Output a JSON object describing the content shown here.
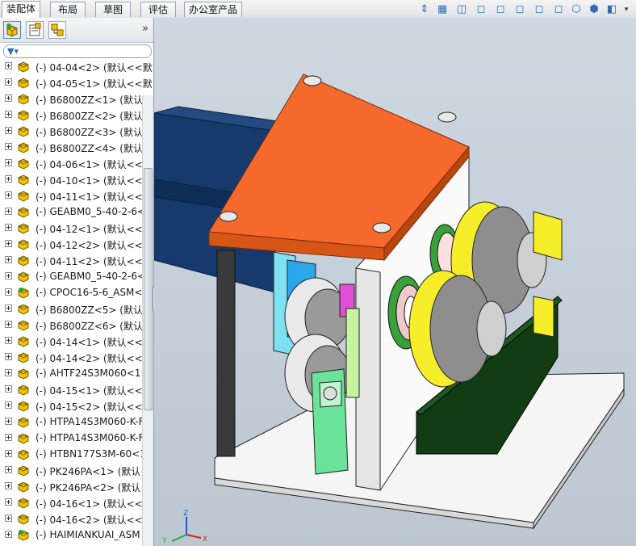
{
  "tabs": [
    "装配体",
    "布局",
    "草图",
    "评估",
    "办公室产品"
  ],
  "active_tab": 0,
  "view_toolbar_icons": [
    "measure-icon",
    "section-view-icon",
    "view-orientation-icon",
    "view-cube-icon",
    "view-cube-icon",
    "view-cube-icon",
    "view-cube-icon",
    "view-cube-icon",
    "display-style-icon",
    "display-style-icon",
    "hide-show-icon"
  ],
  "panel": {
    "tab_icons": [
      "feature-manager-icon",
      "property-manager-icon",
      "configuration-manager-icon"
    ],
    "collapse_label": "»"
  },
  "tree_rows": [
    {
      "label": "(-) 04-04<2> (默认<<默",
      "icon": "part-icon"
    },
    {
      "label": "(-) 04-05<1> (默认<<默",
      "icon": "part-icon"
    },
    {
      "label": "(-) B6800ZZ<1> (默认<",
      "icon": "part-icon"
    },
    {
      "label": "(-) B6800ZZ<2> (默认<",
      "icon": "part-icon"
    },
    {
      "label": "(-) B6800ZZ<3> (默认<",
      "icon": "part-icon"
    },
    {
      "label": "(-) B6800ZZ<4> (默认<",
      "icon": "part-icon"
    },
    {
      "label": "(-) 04-06<1> (默认<<默",
      "icon": "part-icon"
    },
    {
      "label": "(-) 04-10<1> (默认<<默",
      "icon": "part-icon"
    },
    {
      "label": "(-) 04-11<1> (默认<<默",
      "icon": "part-icon"
    },
    {
      "label": "(-) GEABM0_5-40-2-6<",
      "icon": "part-icon"
    },
    {
      "label": "(-) 04-12<1> (默认<<默",
      "icon": "part-icon"
    },
    {
      "label": "(-) 04-12<2> (默认<<默",
      "icon": "part-icon"
    },
    {
      "label": "(-) 04-11<2> (默认<<默",
      "icon": "part-icon"
    },
    {
      "label": "(-) GEABM0_5-40-2-6<",
      "icon": "part-icon"
    },
    {
      "label": "(-) CPOC16-5-6_ASM<",
      "icon": "assembly-icon"
    },
    {
      "label": "(-) B6800ZZ<5> (默认<",
      "icon": "part-icon"
    },
    {
      "label": "(-) B6800ZZ<6> (默认<",
      "icon": "part-icon"
    },
    {
      "label": "(-) 04-14<1> (默认<<默",
      "icon": "part-icon"
    },
    {
      "label": "(-) 04-14<2> (默认<<默",
      "icon": "part-icon"
    },
    {
      "label": "(-) AHTF24S3M060<1>",
      "icon": "part-icon"
    },
    {
      "label": "(-) 04-15<1> (默认<<默",
      "icon": "part-icon"
    },
    {
      "label": "(-) 04-15<2> (默认<<默",
      "icon": "part-icon"
    },
    {
      "label": "(-) HTPA14S3M060-K-F",
      "icon": "part-icon"
    },
    {
      "label": "(-) HTPA14S3M060-K-F",
      "icon": "part-icon"
    },
    {
      "label": "(-) HTBN177S3M-60<1",
      "icon": "part-icon"
    },
    {
      "label": "(-) PK246PA<1> (默认<",
      "icon": "part-icon"
    },
    {
      "label": "(-) PK246PA<2> (默认<",
      "icon": "part-icon"
    },
    {
      "label": "(-) 04-16<1> (默认<<默",
      "icon": "part-icon"
    },
    {
      "label": "(-) 04-16<2> (默认<<默",
      "icon": "part-icon"
    },
    {
      "label": "(-) HAIMIANKUAI_ASM",
      "icon": "assembly-icon"
    }
  ],
  "colors": {
    "base_plate": "#f4f4f4",
    "top_plate": "#f56a2c",
    "motor_block": "#163a6b",
    "gear_housing": "#123d14",
    "yellow_wheels": "#f6ee2a",
    "mint_clamp": "#6be39a",
    "part_icon": "#f2c200"
  },
  "axis_labels": {
    "x": "X",
    "y": "Y",
    "z": "Z"
  }
}
